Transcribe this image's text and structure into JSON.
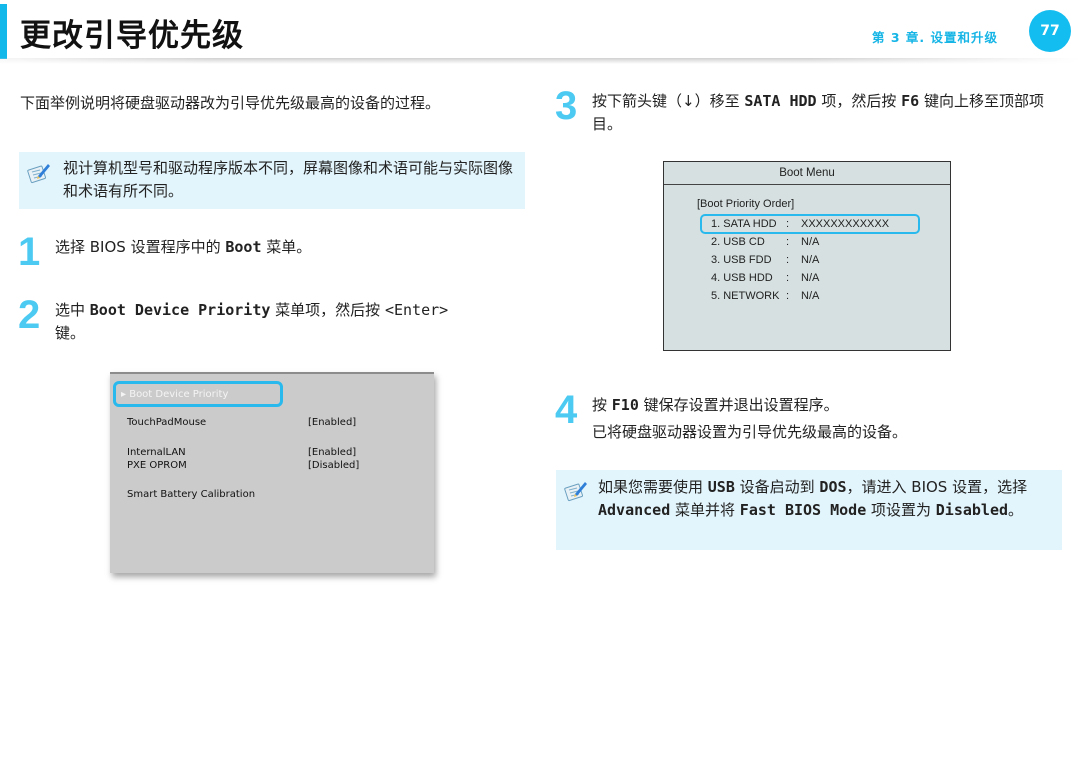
{
  "header": {
    "title": "更改引导优先级",
    "chapter": "第 3 章. 设置和升级",
    "page_number": "77",
    "accent_color": "#13bdf0"
  },
  "intro": "下面举例说明将硬盘驱动器改为引导优先级最高的设备的过程。",
  "note_left": {
    "icon": "note-pencil-icon",
    "text": "视计算机型号和驱动程序版本不同，屏幕图像和术语可能与实际图像和术语有所不同。"
  },
  "steps": [
    {
      "number": "1",
      "parts": [
        "选择 BIOS 设置程序中的 ",
        "Boot",
        " 菜单。"
      ]
    },
    {
      "number": "2",
      "parts": [
        "选中 ",
        "Boot Device Priority",
        " 菜单项，然后按 ",
        "<Enter>",
        " 键。"
      ]
    },
    {
      "number": "3",
      "parts": [
        "按下箭头键（↓）移至 ",
        "SATA HDD",
        " 项，然后按 ",
        "F6",
        " 键向上移至顶部项目。"
      ]
    },
    {
      "number": "4",
      "parts": [
        "按 ",
        "F10",
        " 键保存设置并退出设置程序。"
      ],
      "result": "已将硬盘驱动器设置为引导优先级最高的设备。"
    }
  ],
  "bios_screen": {
    "selected_item": "Boot Device Priority",
    "rows": [
      {
        "label": "TouchPadMouse",
        "value": "[Enabled]"
      },
      {
        "label": "InternalLAN",
        "value": "[Enabled]"
      },
      {
        "label": "PXE OPROM",
        "value": "[Disabled]"
      },
      {
        "label": "Smart Battery Calibration",
        "value": ""
      }
    ]
  },
  "boot_menu": {
    "title": "Boot Menu",
    "subtitle": "[Boot Priority Order]",
    "items": [
      {
        "device": "1. SATA HDD",
        "value": "XXXXXXXXXXXX"
      },
      {
        "device": "2. USB CD",
        "value": "N/A"
      },
      {
        "device": "3. USB FDD",
        "value": "N/A"
      },
      {
        "device": "4. USB HDD",
        "value": "N/A"
      },
      {
        "device": "5. NETWORK",
        "value": "N/A"
      }
    ],
    "separator": ":"
  },
  "note_right": {
    "icon": "note-pencil-icon",
    "parts": [
      "如果您需要使用 ",
      "USB",
      " 设备启动到 ",
      "DOS",
      "，请进入 BIOS 设置，选择 ",
      "Advanced",
      " 菜单并将 ",
      "Fast BIOS Mode",
      " 项设置为 ",
      "Disabled",
      "。"
    ]
  }
}
